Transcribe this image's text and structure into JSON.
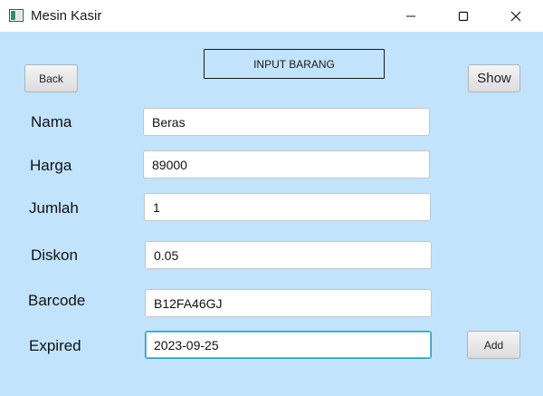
{
  "window": {
    "title": "Mesin Kasir"
  },
  "toolbar": {
    "back_label": "Back",
    "show_label": "Show",
    "header_label": "INPUT BARANG"
  },
  "form": {
    "nama": {
      "label": "Nama",
      "value": "Beras"
    },
    "harga": {
      "label": "Harga",
      "value": "89000"
    },
    "jumlah": {
      "label": "Jumlah",
      "value": "1"
    },
    "diskon": {
      "label": "Diskon",
      "value": "0.05"
    },
    "barcode": {
      "label": "Barcode",
      "value": "B12FA46GJ"
    },
    "expired": {
      "label": "Expired",
      "value": "2023-09-25"
    }
  },
  "actions": {
    "add_label": "Add"
  },
  "colors": {
    "background": "#c1e3fb",
    "focus_border": "#1e9bd3"
  }
}
